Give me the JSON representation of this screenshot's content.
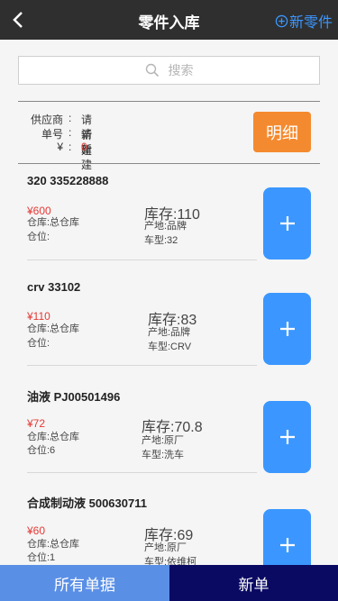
{
  "header": {
    "back_icon": "chevron-left-icon",
    "title": "零件入库",
    "new_part_label": "新零件",
    "new_part_icon": "circle-plus-icon"
  },
  "search": {
    "placeholder": "搜索"
  },
  "info": {
    "supplier_label": "供应商",
    "supplier_value": "请新建",
    "order_label": "单号",
    "order_value": "请新建",
    "amount_label": "¥",
    "amount_value": "0",
    "detail_button": "明细"
  },
  "parts": [
    {
      "name": "320 335228888",
      "price": "¥600",
      "warehouse": "仓库:总仓库",
      "location": "仓位:",
      "stock": "库存:110",
      "origin": "产地:品牌",
      "model": "车型:32"
    },
    {
      "name": "crv 33102",
      "price": "¥110",
      "warehouse": "仓库:总仓库",
      "location": "仓位:",
      "stock": "库存:83",
      "origin": "产地:品牌",
      "model": "车型:CRV"
    },
    {
      "name": "油液 PJ00501496",
      "price": "¥72",
      "warehouse": "仓库:总仓库",
      "location": "仓位:6",
      "stock": "库存:70.8",
      "origin": "产地:原厂",
      "model": "车型:洗车"
    },
    {
      "name": "合成制动液 500630711",
      "price": "¥60",
      "warehouse": "仓库:总仓库",
      "location": "仓位:1",
      "stock": "库存:69",
      "origin": "产地:原厂",
      "model": "车型:依维柯"
    }
  ],
  "tabs": {
    "all": "所有单据",
    "new": "新单"
  },
  "colors": {
    "accent": "#3b97ff",
    "orange": "#f48a2f",
    "red": "#e53935",
    "header": "#2f2f2f",
    "navy": "#0a0a63"
  }
}
